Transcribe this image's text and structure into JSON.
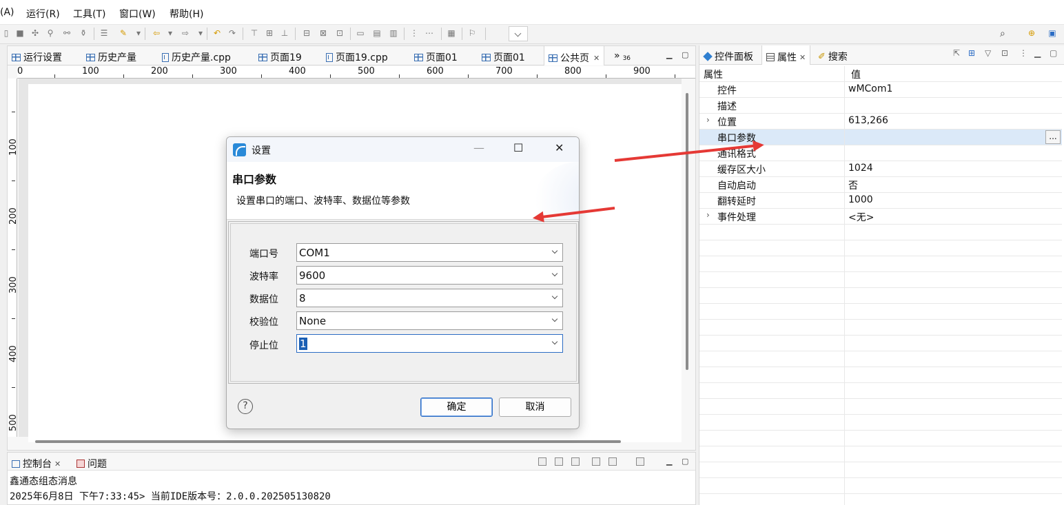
{
  "menu": [
    "(A)",
    "运行(R)",
    "工具(T)",
    "窗口(W)",
    "帮助(H)"
  ],
  "editor_tabs": [
    {
      "label": "运行设置",
      "icon": "grid-icon"
    },
    {
      "label": "历史产量",
      "icon": "grid-icon"
    },
    {
      "label": "历史产量.cpp",
      "icon": "file-icon"
    },
    {
      "label": "页面19",
      "icon": "grid-icon"
    },
    {
      "label": "页面19.cpp",
      "icon": "file-icon"
    },
    {
      "label": "页面01",
      "icon": "grid-icon"
    },
    {
      "label": "页面01",
      "icon": "grid-icon"
    },
    {
      "label": "公共页",
      "icon": "grid-icon",
      "active": true
    }
  ],
  "overflow_tabs": {
    "chevron": "»",
    "count": "36"
  },
  "ruler_h": [
    "0",
    "100",
    "200",
    "300",
    "400",
    "500",
    "600",
    "700",
    "800",
    "900"
  ],
  "ruler_v": [
    "100",
    "200",
    "300",
    "400",
    "500"
  ],
  "console": {
    "tabs": [
      "控制台",
      "问题"
    ],
    "title": "鑫通态组态消息",
    "line": "2025年6月8日 下午7:33:45> 当前IDE版本号：2.0.0.202505130820"
  },
  "right_panel": {
    "tabs": [
      "控件面板",
      "属性",
      "搜索"
    ],
    "header": {
      "key": "属性",
      "value": "值"
    },
    "rows": [
      {
        "key": "控件",
        "value": "wMCom1",
        "expandable": false
      },
      {
        "key": "描述",
        "value": "",
        "expandable": false
      },
      {
        "key": "位置",
        "value": "613,266",
        "expandable": true
      },
      {
        "key": "串口参数",
        "value": "",
        "expandable": false,
        "selected": true,
        "button": "..."
      },
      {
        "key": "通讯格式",
        "value": "",
        "expandable": false
      },
      {
        "key": "缓存区大小",
        "value": "1024",
        "expandable": false
      },
      {
        "key": "自动启动",
        "value": "否",
        "expandable": false
      },
      {
        "key": "翻转延时",
        "value": "1000",
        "expandable": false
      },
      {
        "key": "事件处理",
        "value": "<无>",
        "expandable": true
      }
    ]
  },
  "dialog": {
    "title": "设置",
    "heading": "串口参数",
    "description": "设置串口的端口、波特率、数据位等参数",
    "fields": [
      {
        "label": "端口号",
        "value": "COM1"
      },
      {
        "label": "波特率",
        "value": "9600"
      },
      {
        "label": "数据位",
        "value": "8"
      },
      {
        "label": "校验位",
        "value": "None"
      },
      {
        "label": "停止位",
        "value": "1",
        "focused": true
      }
    ],
    "ok_label": "确定",
    "cancel_label": "取消",
    "help": "?"
  },
  "colors": {
    "accent": "#2b6cc4",
    "arrow": "#e53935",
    "selected_row": "#dbe9f8"
  }
}
